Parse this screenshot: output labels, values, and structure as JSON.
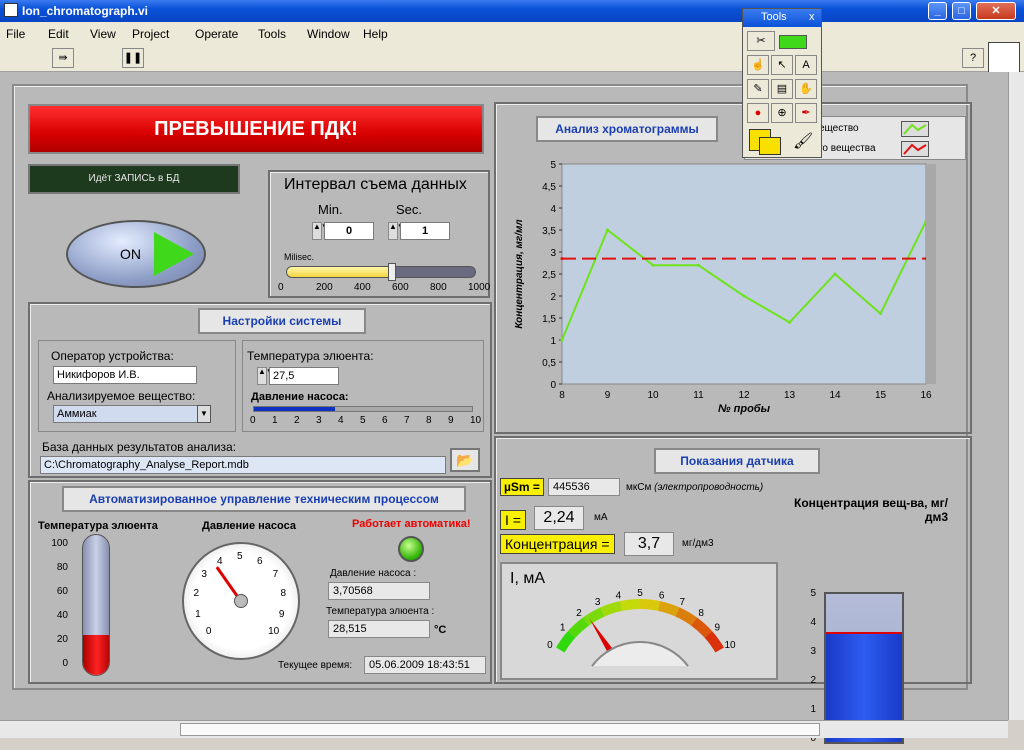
{
  "window": {
    "title": "Ion_chromatograph.vi"
  },
  "menu": [
    "File",
    "Edit",
    "View",
    "Project",
    "Operate",
    "Tools",
    "Window",
    "Help"
  ],
  "alarm": "ПРЕВЫШЕНИЕ ПДК!",
  "db_status": "Идёт ЗАПИСЬ в БД",
  "on_label": "ON",
  "interval": {
    "title": "Интервал съема данных",
    "min_label": "Min.",
    "sec_label": "Sec.",
    "min": "0",
    "sec": "1",
    "ms_label": "Milisec.",
    "ms_ticks": [
      "0",
      "200",
      "400",
      "600",
      "800",
      "1000"
    ],
    "ms_value": 550,
    "ms_max": 1000
  },
  "settings": {
    "title": "Настройки системы",
    "operator_label": "Оператор устройства:",
    "operator": "Никифоров И.В.",
    "substance_label": "Анализируемое вещество:",
    "substance": "Аммиак",
    "temp_label": "Температура элюента:",
    "temp": "27,5",
    "pressure_label": "Давление насоса:",
    "pressure_value": 3.7,
    "pressure_ticks": [
      "0",
      "1",
      "2",
      "3",
      "4",
      "5",
      "6",
      "7",
      "8",
      "9",
      "10"
    ],
    "db_label": "База данных результатов анализа:",
    "db_path": "C:\\Chromatography_Analyse_Report.mdb"
  },
  "auto": {
    "title": "Автоматизированное управление техническим процессом",
    "temp_title": "Температура элюента",
    "temp_ticks": [
      "100",
      "80",
      "60",
      "40",
      "20",
      "0"
    ],
    "temp_level": 28.5,
    "pressure_title": "Давление насоса",
    "dial_ticks": [
      "0",
      "1",
      "2",
      "3",
      "4",
      "5",
      "6",
      "7",
      "8",
      "9",
      "10"
    ],
    "dial_value": 3.7,
    "auto_msg": "Работает автоматика!",
    "pressure_label": "Давление насоса :",
    "pressure": "3,70568",
    "temp_label": "Температура элюента :",
    "temp": "28,515",
    "unit_c": "°С",
    "time_label": "Текущее время:",
    "time": "05.06.2009 18:43:51"
  },
  "sensor": {
    "title": "Показания датчика",
    "usm_label": "µSm =",
    "usm": "445536",
    "usm_unit": "мкСм",
    "usm_note": "(электропроводность)",
    "i_label": "I =",
    "i": "2,24",
    "i_unit": "мА",
    "conc_label": "Концентрация =",
    "conc": "3,7",
    "conc_unit": "мг/дм3",
    "meter_title": "I, мА",
    "meter_ticks": [
      "0",
      "1",
      "2",
      "3",
      "4",
      "5",
      "6",
      "7",
      "8",
      "9",
      "10"
    ],
    "meter_value": 2.24,
    "tank_title": "Концентрация вещ-ва, мг/дм3",
    "tank_ticks": [
      "5",
      "4",
      "3",
      "2",
      "1",
      "0"
    ],
    "tank_value": 3.7,
    "tank_max": 5
  },
  "tools": {
    "title": "Tools",
    "close": "x"
  },
  "legend": [
    "ещество",
    "го вещества"
  ],
  "chart_data": {
    "type": "line",
    "title": "Анализ хроматограммы",
    "xlabel": "№ пробы",
    "ylabel": "Концентрация, мг/мл",
    "xlim": [
      8,
      16
    ],
    "ylim": [
      0,
      5
    ],
    "xticks": [
      8,
      9,
      10,
      11,
      12,
      13,
      14,
      15,
      16
    ],
    "yticks": [
      "0",
      "0,5",
      "1",
      "1,5",
      "2",
      "2,5",
      "3",
      "3,5",
      "4",
      "4,5",
      "5"
    ],
    "series": [
      {
        "name": "ещество",
        "x": [
          8,
          9,
          10,
          11,
          12,
          13,
          14,
          15,
          16
        ],
        "y": [
          1.0,
          3.5,
          2.7,
          2.7,
          2.0,
          1.4,
          2.5,
          1.6,
          3.7
        ],
        "color": "#6ee21a"
      },
      {
        "name": "го вещества",
        "x": [
          8,
          16
        ],
        "y": [
          2.85,
          2.85
        ],
        "color": "#e01010",
        "dashed": true
      }
    ]
  }
}
